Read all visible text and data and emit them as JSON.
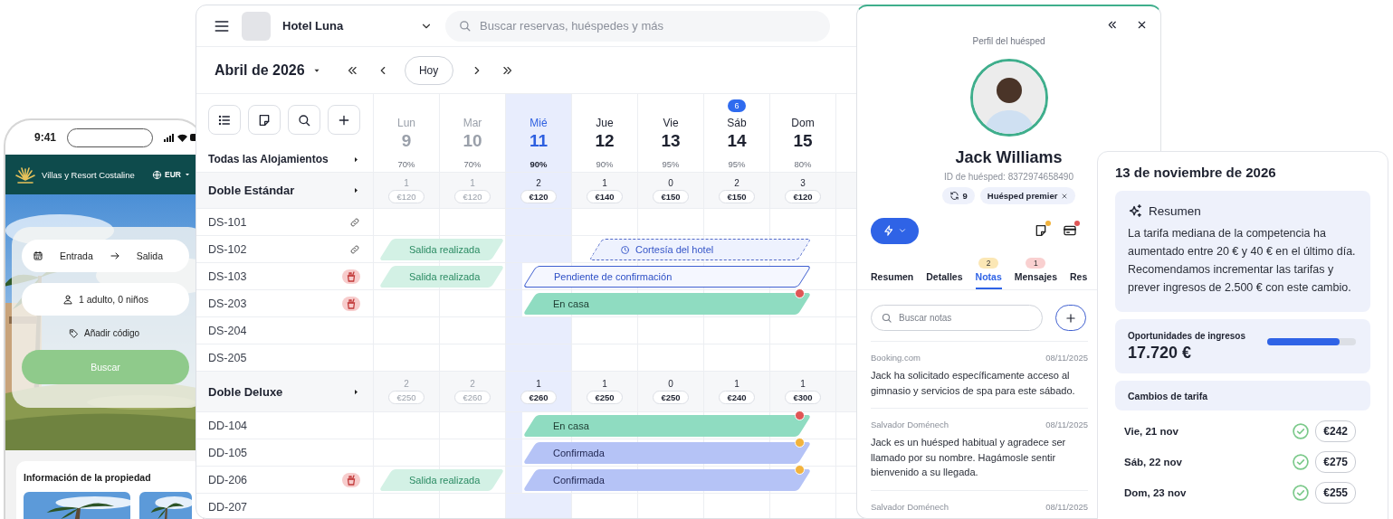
{
  "phone": {
    "time": "9:41",
    "brand": "Villas y Resort Costaline",
    "currency": "EUR",
    "check_in": "Entrada",
    "check_out": "Salida",
    "guests": "1 adulto, 0 niños",
    "promo": "Añadir código",
    "search_button": "Buscar",
    "section_title": "Información de la propiedad"
  },
  "calendar": {
    "property": "Hotel Luna",
    "search": {
      "placeholder": "Buscar reservas, huéspedes y más"
    },
    "month": "Abril de 2026",
    "today_button": "Hoy",
    "all_label": "Todas las Alojamientos",
    "days": [
      {
        "name": "Lun",
        "number": "9",
        "occupancy": "70%",
        "past": true,
        "selected": false
      },
      {
        "name": "Mar",
        "number": "10",
        "occupancy": "70%",
        "past": true,
        "selected": false
      },
      {
        "name": "Mié",
        "number": "11",
        "occupancy": "90%",
        "past": false,
        "selected": true
      },
      {
        "name": "Jue",
        "number": "12",
        "occupancy": "90%",
        "past": false,
        "selected": false
      },
      {
        "name": "Vie",
        "number": "13",
        "occupancy": "95%",
        "past": false,
        "selected": false
      },
      {
        "name": "Sáb",
        "number": "14",
        "occupancy": "95%",
        "past": false,
        "selected": false,
        "badge": "6"
      },
      {
        "name": "Dom",
        "number": "15",
        "occupancy": "80%",
        "past": false,
        "selected": false
      }
    ],
    "groups": [
      {
        "name": "Doble Estándar",
        "availability": [
          {
            "count": "1",
            "price": "€120"
          },
          {
            "count": "1",
            "price": "€120"
          },
          {
            "count": "2",
            "price": "€120"
          },
          {
            "count": "1",
            "price": "€140"
          },
          {
            "count": "0",
            "price": "€150"
          },
          {
            "count": "2",
            "price": "€150"
          },
          {
            "count": "3",
            "price": "€120"
          }
        ],
        "rooms": [
          {
            "name": "DS-101",
            "linked": true,
            "cleaning": false
          },
          {
            "name": "DS-102",
            "linked": true,
            "cleaning": false,
            "bookings": [
              {
                "kind": "checked-out",
                "label": "Salida realizada"
              },
              {
                "kind": "courtesy",
                "label": "Cortesía del hotel"
              }
            ]
          },
          {
            "name": "DS-103",
            "linked": false,
            "cleaning": true,
            "bookings": [
              {
                "kind": "checked-out",
                "label": "Salida realizada"
              },
              {
                "kind": "pending",
                "label": "Pendiente de confirmación"
              }
            ]
          },
          {
            "name": "DS-203",
            "linked": false,
            "cleaning": true,
            "bookings": [
              {
                "kind": "in-house",
                "label": "En casa"
              }
            ]
          },
          {
            "name": "DS-204",
            "linked": false,
            "cleaning": false
          },
          {
            "name": "DS-205",
            "linked": false,
            "cleaning": false
          }
        ]
      },
      {
        "name": "Doble Deluxe",
        "availability": [
          {
            "count": "2",
            "price": "€250"
          },
          {
            "count": "2",
            "price": "€260"
          },
          {
            "count": "1",
            "price": "€260"
          },
          {
            "count": "1",
            "price": "€250"
          },
          {
            "count": "0",
            "price": "€250"
          },
          {
            "count": "1",
            "price": "€240"
          },
          {
            "count": "1",
            "price": "€300"
          }
        ],
        "rooms": [
          {
            "name": "DD-104",
            "linked": false,
            "cleaning": false,
            "bookings": [
              {
                "kind": "in-house",
                "label": "En casa"
              }
            ]
          },
          {
            "name": "DD-105",
            "linked": false,
            "cleaning": false,
            "bookings": [
              {
                "kind": "confirmed",
                "label": "Confirmada"
              }
            ]
          },
          {
            "name": "DD-206",
            "linked": false,
            "cleaning": true,
            "bookings": [
              {
                "kind": "checked-out",
                "label": "Salida realizada"
              },
              {
                "kind": "confirmed",
                "label": "Confirmada"
              }
            ]
          },
          {
            "name": "DD-207",
            "linked": false,
            "cleaning": false
          }
        ]
      }
    ]
  },
  "profile": {
    "title": "Perfil del huésped",
    "name": "Jack Williams",
    "guest_id": "ID de huésped: 8372974658490",
    "stays": "9",
    "tags": [
      {
        "label": "Huésped premier"
      }
    ],
    "tabs": [
      {
        "label": "Resumen",
        "selected": false
      },
      {
        "label": "Detalles",
        "selected": false
      },
      {
        "label": "Notas",
        "selected": true,
        "badge": "2",
        "color": "#fbe7b5"
      },
      {
        "label": "Mensajes",
        "selected": false,
        "badge": "1",
        "color": "#f9d0d0"
      },
      {
        "label": "Res",
        "selected": false
      }
    ],
    "notes_search": {
      "placeholder": "Buscar notas"
    },
    "notes": [
      {
        "source": "Booking.com",
        "date": "08/11/2025",
        "text": "Jack ha solicitado específicamente acceso al gimnasio y servicios de spa para este sábado."
      },
      {
        "source": "Salvador Doménech",
        "date": "08/11/2025",
        "text": "Jack es un huésped habitual y agradece ser llamado por su nombre. Hagámosle sentir bienvenido a su llegada."
      },
      {
        "source": "Salvador Doménech",
        "date": "08/11/2025"
      }
    ]
  },
  "rates": {
    "date": "13 de noviembre de 2026",
    "summary": {
      "title": "Resumen",
      "text": "La tarifa mediana de la competencia ha aumentado entre 20 € y 40 € en el último día. Recomendamos incrementar las tarifas y prever ingresos de 2.500 € con este cambio."
    },
    "revenue": {
      "label": "Oportunidades de ingresos",
      "value": "17.720 €",
      "level": 0.82
    },
    "changes": {
      "title": "Cambios de tarifa",
      "rows": [
        {
          "day": "Vie, 21 nov",
          "price": "€242",
          "approved": true
        },
        {
          "day": "Sáb, 22 nov",
          "price": "€275",
          "approved": true
        },
        {
          "day": "Dom, 23 nov",
          "price": "€255",
          "approved": true
        }
      ]
    }
  }
}
